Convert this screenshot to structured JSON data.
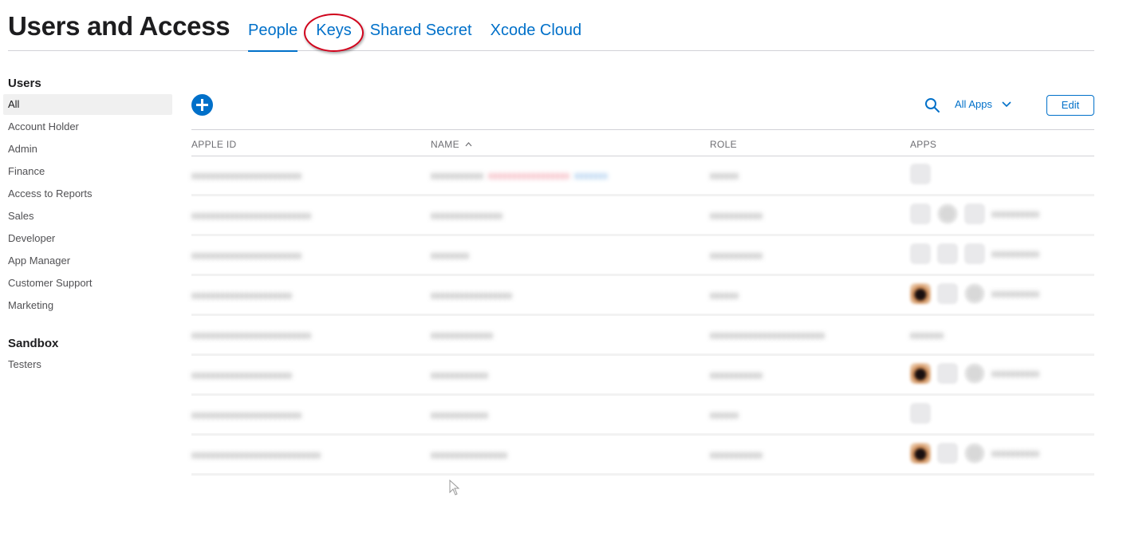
{
  "header": {
    "title": "Users and Access",
    "tabs": [
      {
        "label": "People",
        "active": true
      },
      {
        "label": "Keys",
        "active": false,
        "highlighted": true
      },
      {
        "label": "Shared Secret",
        "active": false
      },
      {
        "label": "Xcode Cloud",
        "active": false
      }
    ]
  },
  "sidebar": {
    "users_heading": "Users",
    "users_items": [
      {
        "label": "All",
        "selected": true
      },
      {
        "label": "Account Holder"
      },
      {
        "label": "Admin"
      },
      {
        "label": "Finance"
      },
      {
        "label": "Access to Reports"
      },
      {
        "label": "Sales"
      },
      {
        "label": "Developer"
      },
      {
        "label": "App Manager"
      },
      {
        "label": "Customer Support"
      },
      {
        "label": "Marketing"
      }
    ],
    "sandbox_heading": "Sandbox",
    "sandbox_items": [
      {
        "label": "Testers"
      }
    ]
  },
  "toolbar": {
    "add_icon": "plus-circle-icon",
    "search_icon": "search-icon",
    "apps_filter_label": "All Apps",
    "edit_label": "Edit"
  },
  "table": {
    "columns": {
      "apple_id": "APPLE ID",
      "name": "NAME",
      "name_sort_indicator": "^",
      "role": "ROLE",
      "apps": "APPS"
    }
  },
  "colors": {
    "accent": "#0070c9",
    "highlight_circle": "#d0021b",
    "title_text": "#1d1d1f",
    "secondary_text": "#515154",
    "divider": "#d2d2d7"
  }
}
